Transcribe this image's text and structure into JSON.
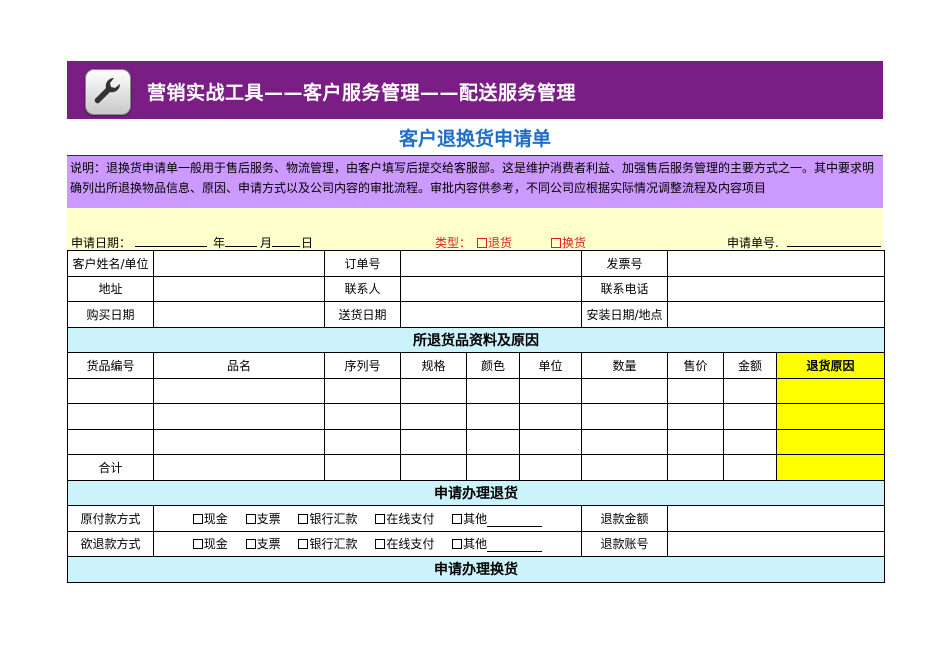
{
  "banner": {
    "title": "营销实战工具——客户服务管理——配送服务管理",
    "icon": "wrench-icon"
  },
  "form_title": "客户退换货申请单",
  "description": "说明：退换货申请单一般用于售后服务、物流管理，由客户填写后提交给客服部。这是维护消费者利益、加强售后服务管理的主要方式之一。其中要求明确列出所退换物品信息、原因、申请方式以及公司内容的审批流程。审批内容供参考，不同公司应根据实际情况调整流程及内容项目",
  "apply_row": {
    "date_label": "申请日期：",
    "year": "年",
    "month": "月",
    "day": "日",
    "type_label": "类型：",
    "type_return": "退货",
    "type_exchange": "换货",
    "order_no_label": "申请单号."
  },
  "customer": {
    "name_label": "客户姓名/单位",
    "order_label": "订单号",
    "invoice_label": "发票号",
    "address_label": "地址",
    "contact_label": "联系人",
    "phone_label": "联系电话",
    "purchase_date_label": "购买日期",
    "delivery_date_label": "送货日期",
    "install_label": "安装日期/地点"
  },
  "goods_section": {
    "title": "所退货品资料及原因",
    "headers": [
      "货品编号",
      "品名",
      "序列号",
      "规格",
      "颜色",
      "单位",
      "数量",
      "售价",
      "金额",
      "退货原因"
    ],
    "total_label": "合计"
  },
  "return_section": {
    "title": "申请办理退货",
    "orig_pay_label": "原付款方式",
    "refund_pay_label": "欲退款方式",
    "options": [
      "现金",
      "支票",
      "银行汇款",
      "在线支付",
      "其他"
    ],
    "refund_amount_label": "退款金额",
    "refund_account_label": "退款账号"
  },
  "exchange_section": {
    "title": "申请办理换货"
  },
  "colors": {
    "banner": "#7a1e86",
    "title_blue": "#1f6fc6",
    "desc_bg": "#cc99ff",
    "apply_bg": "#ffffcc",
    "section_bg": "#ccf2fb",
    "reason_bg": "#ffff00",
    "type_red": "#e02020"
  }
}
